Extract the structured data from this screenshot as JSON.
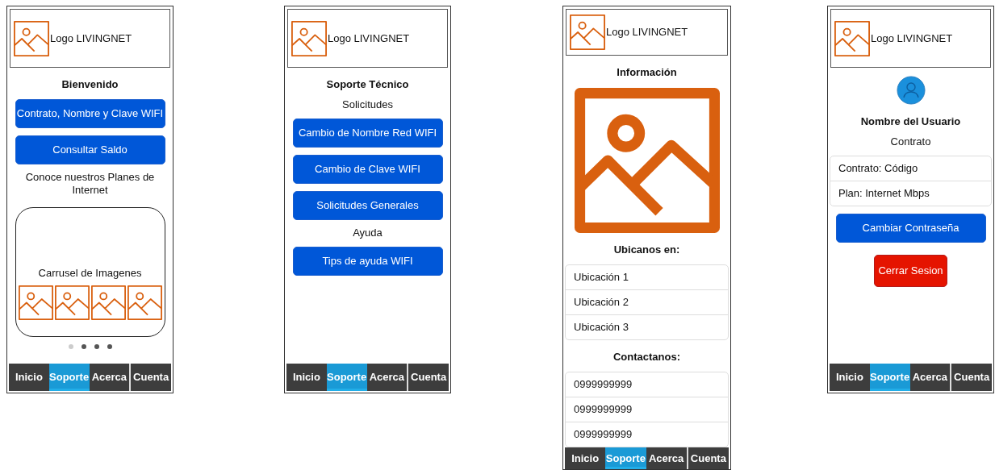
{
  "screens": [
    {
      "logo": "Logo LIVINGNET",
      "content": [
        {
          "kind": "heading",
          "text": "Bienvenido"
        },
        {
          "kind": "button",
          "label": "Contrato, Nombre y Clave WIFI"
        },
        {
          "kind": "button",
          "label": "Consultar Saldo"
        },
        {
          "kind": "text",
          "text": "Conoce nuestros Planes de Internet"
        },
        {
          "kind": "carousel",
          "caption": "Carrusel de Imagenes",
          "dots": [
            {
              "selected": true
            },
            {
              "selected": false
            },
            {
              "selected": false
            },
            {
              "selected": false
            }
          ]
        }
      ],
      "nav": [
        {
          "label": "Inicio",
          "selected": false
        },
        {
          "label": "Soporte",
          "selected": true
        },
        {
          "label": "Acerca",
          "selected": false
        },
        {
          "label": "Cuenta",
          "selected": false
        }
      ]
    },
    {
      "logo": "Logo LIVINGNET",
      "content": [
        {
          "kind": "heading",
          "text": "Soporte Técnico"
        },
        {
          "kind": "text",
          "text": "Solicitudes"
        },
        {
          "kind": "button",
          "label": "Cambio de Nombre Red WIFI"
        },
        {
          "kind": "button",
          "label": "Cambio de Clave WIFI"
        },
        {
          "kind": "button",
          "label": "Solicitudes Generales"
        },
        {
          "kind": "text",
          "text": "Ayuda"
        },
        {
          "kind": "button",
          "label": "Tips de ayuda WIFI"
        }
      ],
      "nav": [
        {
          "label": "Inicio",
          "selected": false
        },
        {
          "label": "Soporte",
          "selected": true
        },
        {
          "label": "Acerca",
          "selected": false
        },
        {
          "label": "Cuenta",
          "selected": false
        }
      ]
    },
    {
      "logo": "Logo LIVINGNET",
      "content": [
        {
          "kind": "heading",
          "text": "Información"
        },
        {
          "kind": "image"
        },
        {
          "kind": "heading",
          "text": "Ubicanos en:"
        },
        {
          "kind": "list",
          "items": [
            "Ubicación 1",
            "Ubicación 2",
            "Ubicación 3"
          ]
        },
        {
          "kind": "heading",
          "text": "Contactanos:"
        },
        {
          "kind": "list",
          "items": [
            "0999999999",
            "0999999999",
            "0999999999"
          ]
        }
      ],
      "nav": [
        {
          "label": "Inicio",
          "selected": false
        },
        {
          "label": "Soporte",
          "selected": true
        },
        {
          "label": "Acerca",
          "selected": false
        },
        {
          "label": "Cuenta",
          "selected": false
        }
      ]
    },
    {
      "logo": "Logo LIVINGNET",
      "content": [
        {
          "kind": "avatar"
        },
        {
          "kind": "heading",
          "text": "Nombre del Usuario"
        },
        {
          "kind": "text",
          "text": "Contrato"
        },
        {
          "kind": "list",
          "items": [
            "Contrato: Código",
            "Plan: Internet Mbps"
          ]
        },
        {
          "kind": "button",
          "label": "Cambiar Contraseña"
        },
        {
          "kind": "danger_button",
          "label": "Cerrar Sesion"
        }
      ],
      "nav": [
        {
          "label": "Inicio",
          "selected": false
        },
        {
          "label": "Soporte",
          "selected": true
        },
        {
          "label": "Acerca",
          "selected": false
        },
        {
          "label": "Cuenta",
          "selected": false
        }
      ]
    }
  ]
}
